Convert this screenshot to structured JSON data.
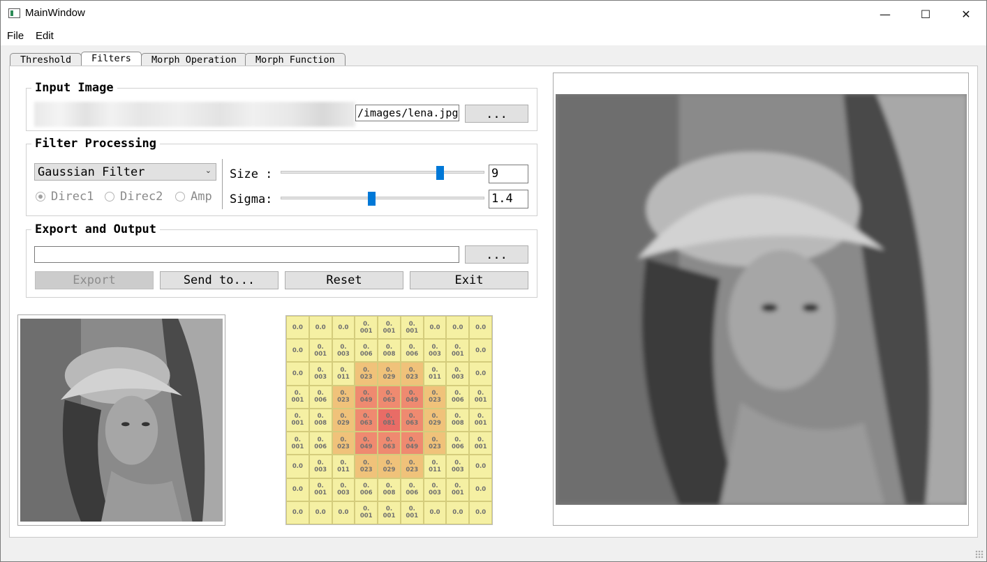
{
  "window": {
    "title": "MainWindow",
    "controls": {
      "minimize": "—",
      "maximize": "☐",
      "close": "✕"
    }
  },
  "menu": {
    "items": [
      "File",
      "Edit"
    ]
  },
  "tabs": [
    {
      "label": "Threshold",
      "active": false
    },
    {
      "label": "Filters",
      "active": true
    },
    {
      "label": "Morph Operation",
      "active": false
    },
    {
      "label": "Morph Function",
      "active": false
    }
  ],
  "input_image": {
    "title": "Input Image",
    "path_visible": "/images/lena.jpg",
    "browse_label": "..."
  },
  "filter_processing": {
    "title": "Filter Processing",
    "filter_select": "Gaussian Filter",
    "radios": [
      {
        "label": "Direc1",
        "checked": true
      },
      {
        "label": "Direc2",
        "checked": false
      },
      {
        "label": "Amp",
        "checked": false
      }
    ],
    "size": {
      "label": "Size :",
      "value": "9",
      "slider_fraction": 0.78
    },
    "sigma": {
      "label": "Sigma:",
      "value": "1.4",
      "slider_fraction": 0.45
    }
  },
  "export_output": {
    "title": "Export and Output",
    "path_value": "",
    "browse_label": "...",
    "buttons": {
      "export": "Export",
      "send_to": "Send to...",
      "reset": "Reset",
      "exit": "Exit"
    }
  },
  "kernel": {
    "size": 9,
    "cells": [
      [
        "0.0",
        "0.0",
        "0.0",
        "0.\n001",
        "0.\n001",
        "0.\n001",
        "0.0",
        "0.0",
        "0.0"
      ],
      [
        "0.0",
        "0.\n001",
        "0.\n003",
        "0.\n006",
        "0.\n008",
        "0.\n006",
        "0.\n003",
        "0.\n001",
        "0.0"
      ],
      [
        "0.0",
        "0.\n003",
        "0.\n011",
        "0.\n023",
        "0.\n029",
        "0.\n023",
        "0.\n011",
        "0.\n003",
        "0.0"
      ],
      [
        "0.\n001",
        "0.\n006",
        "0.\n023",
        "0.\n049",
        "0.\n063",
        "0.\n049",
        "0.\n023",
        "0.\n006",
        "0.\n001"
      ],
      [
        "0.\n001",
        "0.\n008",
        "0.\n029",
        "0.\n063",
        "0.\n081",
        "0.\n063",
        "0.\n029",
        "0.\n008",
        "0.\n001"
      ],
      [
        "0.\n001",
        "0.\n006",
        "0.\n023",
        "0.\n049",
        "0.\n063",
        "0.\n049",
        "0.\n023",
        "0.\n006",
        "0.\n001"
      ],
      [
        "0.0",
        "0.\n003",
        "0.\n011",
        "0.\n023",
        "0.\n029",
        "0.\n023",
        "0.\n011",
        "0.\n003",
        "0.0"
      ],
      [
        "0.0",
        "0.\n001",
        "0.\n003",
        "0.\n006",
        "0.\n008",
        "0.\n006",
        "0.\n003",
        "0.\n001",
        "0.0"
      ],
      [
        "0.0",
        "0.0",
        "0.0",
        "0.\n001",
        "0.\n001",
        "0.\n001",
        "0.0",
        "0.0",
        "0.0"
      ]
    ],
    "colors": {
      "low": "#f5f0a3",
      "mid": "#f0c27a",
      "high": "#ef8a70",
      "peak": "#e96c66"
    }
  }
}
